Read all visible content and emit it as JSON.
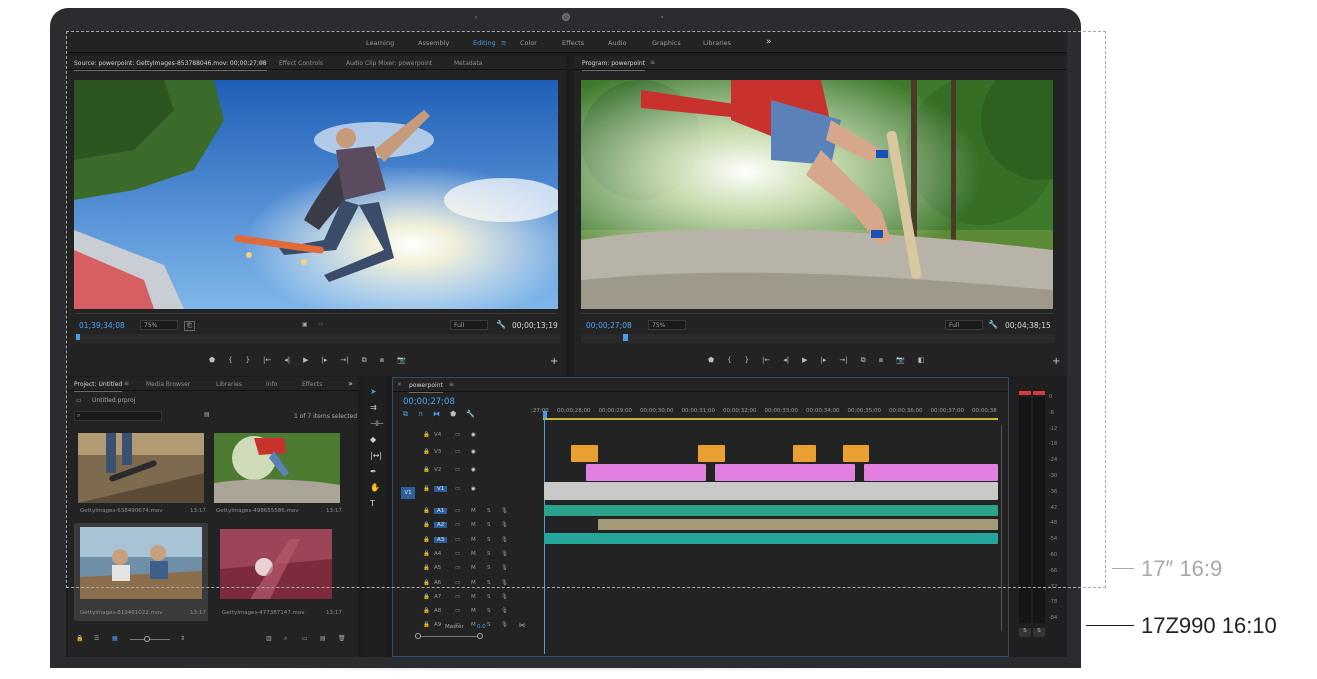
{
  "workspaces": {
    "items": [
      "Learning",
      "Assembly",
      "Editing",
      "Color",
      "Effects",
      "Audio",
      "Graphics",
      "Libraries"
    ],
    "active": "Editing",
    "overflow": "»"
  },
  "source_monitor": {
    "tabs": [
      "Source: powerpoint: GettyImages-853788046.mov: 00;00;27;08",
      "Effect Controls",
      "Audio Clip Mixer: powerpoint",
      "Metadata"
    ],
    "timecode_current": "01;39;34;08",
    "zoom": "75%",
    "quality": "Full",
    "timecode_duration": "00;00;13;19"
  },
  "program_monitor": {
    "title": "Program: powerpoint",
    "timecode_current": "00;00;27;08",
    "zoom": "75%",
    "quality": "Full",
    "timecode_duration": "00;04;38;15"
  },
  "project_panel": {
    "tabs": [
      "Project: Untitled",
      "Media Browser",
      "Libraries",
      "Info",
      "Effects"
    ],
    "file": "Untitled.prproj",
    "items_selected": "1 of 7 items selected",
    "clips": [
      {
        "name": "GettyImages-638490674.mov",
        "duration": "13:17"
      },
      {
        "name": "GettyImages-498655586.mov",
        "duration": "13:17"
      },
      {
        "name": "GettyImages-819461022.mov",
        "duration": "13:17"
      },
      {
        "name": "GettyImages-477387147.mov",
        "duration": "13:17"
      }
    ]
  },
  "timeline": {
    "sequence": "powerpoint",
    "timecode": "00;00;27;08",
    "ruler": [
      "00;00;28;00",
      "00;00;29;00",
      "00;00;30;00",
      "00;00;31;00",
      "00;00;32;00",
      "00;00;33;00",
      "00;00;34;00",
      "00;00;35;00",
      "00;00;36;00",
      "00;00;37;00",
      "00;00;38"
    ],
    "ruler_start": ";27;00",
    "video_tracks": [
      "V4",
      "V3",
      "V2",
      "V1"
    ],
    "audio_tracks": [
      "A1",
      "A2",
      "A3",
      "A4",
      "A5",
      "A6",
      "A7",
      "A8",
      "A9"
    ],
    "master_label": "Master",
    "master_value": "0.0",
    "source_patch_v": "V1",
    "mute": "M",
    "solo": "S"
  },
  "meter": {
    "scale": [
      "0",
      "-6",
      "-12",
      "-18",
      "-24",
      "-30",
      "-36",
      "-42",
      "-48",
      "-54",
      "-60",
      "-66",
      "-72",
      "-78",
      "-84"
    ],
    "solo_labels": [
      "S",
      "S"
    ]
  },
  "annotations": {
    "label_17": "17″ 16:9",
    "label_990": "17Z990 16:10"
  },
  "colors": {
    "accent_blue": "#4c9be8",
    "clip_orange": "#e8a033",
    "clip_pink": "#e27fe0",
    "clip_gray": "#c9c9c9",
    "audio_teal": "#2aa38a",
    "audio_tan": "#a59a78"
  }
}
